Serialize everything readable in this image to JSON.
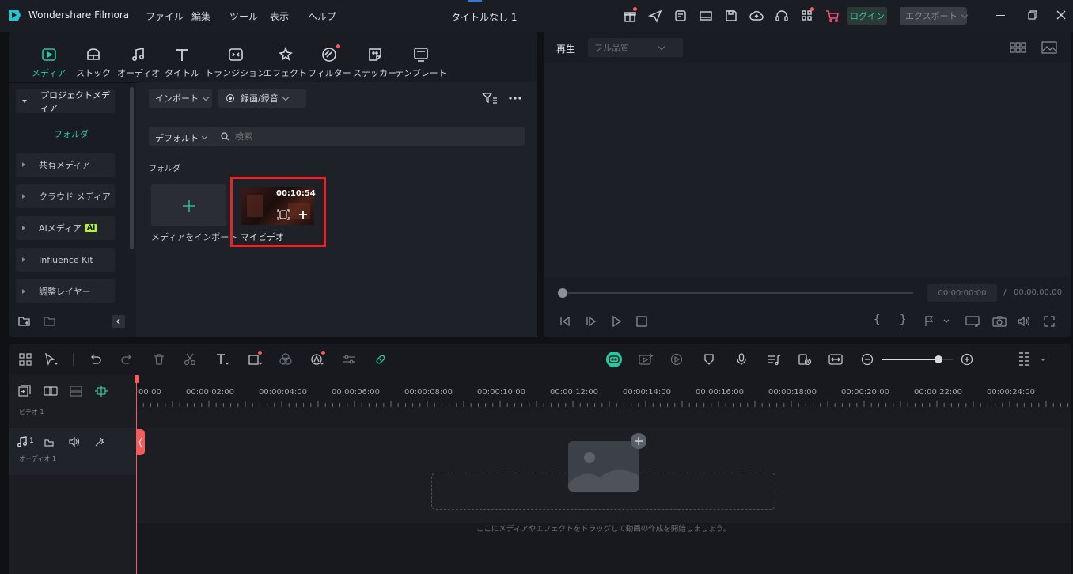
{
  "app": {
    "name": "Wondershare Filmora",
    "project_title": "タイトルなし 1"
  },
  "menu": [
    "ファイル",
    "編集",
    "ツール",
    "表示",
    "ヘルプ"
  ],
  "titlebar": {
    "login_label": "ログイン",
    "export_label": "エクスポート"
  },
  "tabs": [
    {
      "label": "メディア",
      "icon": "media-icon",
      "active": true
    },
    {
      "label": "ストック",
      "icon": "stock-icon"
    },
    {
      "label": "オーディオ",
      "icon": "music-note-icon"
    },
    {
      "label": "タイトル",
      "icon": "title-t-icon"
    },
    {
      "label": "トランジション",
      "icon": "transition-icon"
    },
    {
      "label": "エフェクト",
      "icon": "effect-star-icon"
    },
    {
      "label": "フィルター",
      "icon": "filter-icon"
    },
    {
      "label": "ステッカー",
      "icon": "sticker-icon"
    },
    {
      "label": "テンプレート",
      "icon": "template-icon"
    }
  ],
  "sidebar": {
    "project_media": "プロジェクトメディア",
    "folder": "フォルダ",
    "items": [
      {
        "label": "共有メディア"
      },
      {
        "label": "クラウド メディア"
      },
      {
        "label": "AIメディア",
        "badge": "AI"
      },
      {
        "label": "Influence Kit"
      },
      {
        "label": "調整レイヤー"
      }
    ]
  },
  "media": {
    "import_label": "インポート",
    "record_label": "録画/録音",
    "sort_label": "デフォルト",
    "search_placeholder": "検索",
    "section_label": "フォルダ",
    "import_tile_label": "メディアをインポート",
    "clip": {
      "name": "マイビデオ",
      "duration": "00:10:54"
    }
  },
  "preview": {
    "tab_label": "再生",
    "quality_label": "フル品質",
    "current_time": "00:00:00:00",
    "separator": "/",
    "total_time": "00:00:00:00",
    "progress": 0
  },
  "timeline": {
    "ruler": [
      "00:00",
      "00:00:02:00",
      "00:00:04:00",
      "00:00:06:00",
      "00:00:08:00",
      "00:00:10:00",
      "00:00:12:00",
      "00:00:14:00",
      "00:00:16:00",
      "00:00:18:00",
      "00:00:20:00",
      "00:00:22:00",
      "00:00:24:00"
    ],
    "video_track_label": "ビデオ 1",
    "audio_track_number": "1",
    "audio_track_label": "オーディオ 1",
    "drop_hint": "ここにメディアやエフェクトをドラッグして動画の作成を開始しましょう。",
    "zoom_level": 0.8
  },
  "colors": {
    "accent": "#27c8a2",
    "highlight_box": "#e3262c",
    "playhead": "#f25c5c"
  }
}
